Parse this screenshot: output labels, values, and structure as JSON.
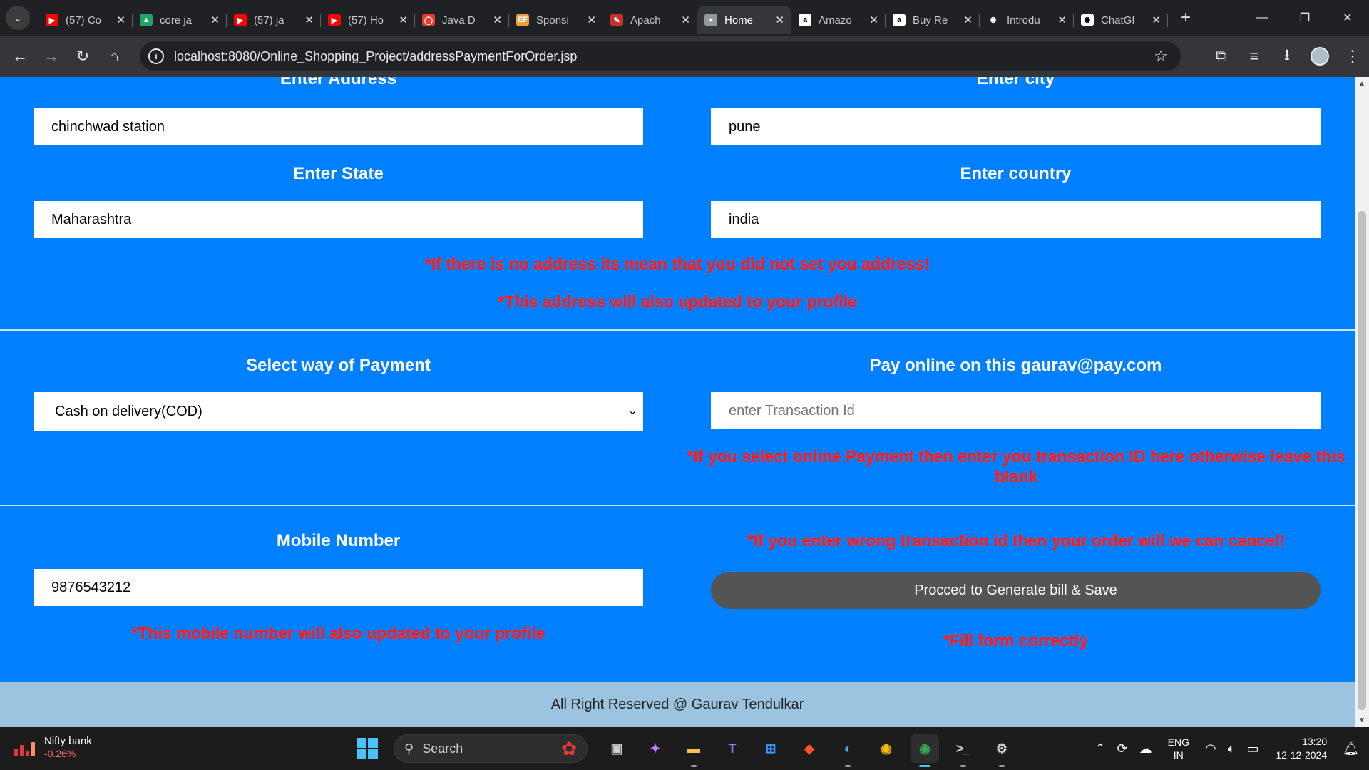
{
  "browser": {
    "tabs": [
      {
        "title": "(57) Co",
        "favicon": "youtube-icon",
        "color": "#ff0000",
        "glyph": "▶"
      },
      {
        "title": "core ja",
        "favicon": "google-drive-icon",
        "color": "#1fa463",
        "glyph": "▲"
      },
      {
        "title": "(57) ja",
        "favicon": "youtube-icon",
        "color": "#ff0000",
        "glyph": "▶"
      },
      {
        "title": "(57) Ho",
        "favicon": "youtube-icon",
        "color": "#ff0000",
        "glyph": "▶"
      },
      {
        "title": "Java D",
        "favicon": "oracle-icon",
        "color": "#e33b2e",
        "glyph": "◯"
      },
      {
        "title": "Sponsi",
        "favicon": "sponsor-icon",
        "color": "#e8a23b",
        "glyph": "EF"
      },
      {
        "title": "Apach",
        "favicon": "apache-icon",
        "color": "#c9302c",
        "glyph": "✎"
      },
      {
        "title": "Home",
        "favicon": "globe-icon",
        "color": "#8e9aa0",
        "glyph": "●",
        "active": true
      },
      {
        "title": "Amazo",
        "favicon": "amazon-icon",
        "color": "#ffffff",
        "glyph": "a"
      },
      {
        "title": "Buy Re",
        "favicon": "amazon-icon",
        "color": "#ffffff",
        "glyph": "a"
      },
      {
        "title": "Introdu",
        "favicon": "openai-icon",
        "color": "#202124",
        "glyph": "✺"
      },
      {
        "title": "ChatGI",
        "favicon": "chatgpt-icon",
        "color": "#ffffff",
        "glyph": "✺"
      }
    ],
    "url": "localhost:8080/Online_Shopping_Project/addressPaymentForOrder.jsp"
  },
  "form": {
    "address_heading": "Enter Address",
    "address_value": "chinchwad station",
    "city_heading": "Enter city",
    "city_value": "pune",
    "state_heading": "Enter State",
    "state_value": "Maharashtra",
    "country_heading": "Enter country",
    "country_value": "india",
    "address_note_1": "*If there is no address its mean that you did not set you address!",
    "address_note_2": "*This address will also updated to your profile",
    "payment_heading": "Select way of Payment",
    "payment_selected": "Cash on delivery(COD)",
    "pay_online_heading": "Pay online on this gaurav@pay.com",
    "transaction_placeholder": "enter Transaction Id",
    "transaction_note": "*If you select online Payment then enter you transaction ID here otherwise leave this blank",
    "mobile_heading": "Mobile Number",
    "mobile_value": "9876543212",
    "wrong_txn_note": "*If you enter wrong transaction id then your order will we can cancel!",
    "submit_label": "Procced to Generate bill & Save",
    "mobile_note": "*This mobile number will also updated to your profile",
    "fill_note": "*Fill form correctly"
  },
  "footer": {
    "text": "All Right Reserved @ Gaurav Tendulkar"
  },
  "taskbar": {
    "widget_title": "Nifty bank",
    "widget_value": "-0.26%",
    "search_placeholder": "Search",
    "lang_line1": "ENG",
    "lang_line2": "IN",
    "time": "13:20",
    "date": "12-12-2024"
  }
}
